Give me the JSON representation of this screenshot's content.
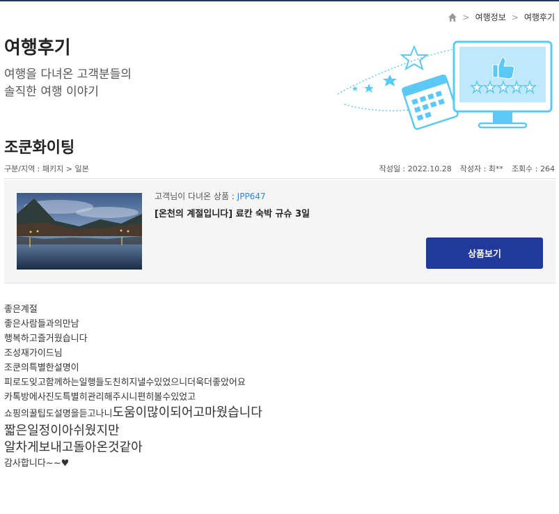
{
  "breadcrumb": {
    "items": [
      "여행정보",
      "여행후기"
    ]
  },
  "header": {
    "title": "여행후기",
    "subtitle_lines": [
      "여행을 다녀온 고객분들의",
      "솔직한 여행 이야기"
    ]
  },
  "post": {
    "title": "조쿤화이팅",
    "category": "구분/지역 : 패키지 > 일본",
    "date": "작성일 : 2022.10.28",
    "author": "작성자 : 최**",
    "views": "조회수 : 264"
  },
  "product": {
    "label": "고객님이 다녀온 상품 : ",
    "code": "JPP647",
    "name": "[온천의 계절입니다] 료칸 숙박 규슈 3일",
    "button_label": "상품보기"
  },
  "body": {
    "lines": [
      "좋은계절",
      "좋은사람들과의만남",
      "행복하고즐거웠습니다",
      "조성재가이드님",
      "조쿤의특별한설명이",
      "피로도잊고함께하는일행들도친히지낼수있었으니더욱더좋았어요",
      "카톡방에사진도특별히관리해주시니편히볼수있었고",
      "쇼핑의꿀팁도설명을듣고나니",
      "도움이많이되어고마웠습니다",
      "짧은일정이아쉬웠지만",
      "알차게보내고돌아온것같아",
      "감사합니다~~♥"
    ]
  },
  "colors": {
    "accent": "#21399a",
    "link": "#2e86de",
    "illustration": "#5bc8f5"
  }
}
